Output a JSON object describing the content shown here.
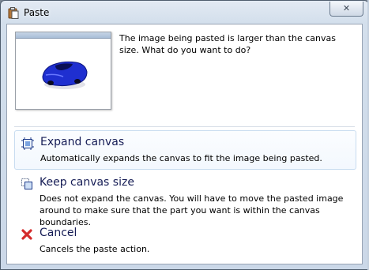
{
  "window": {
    "title": "Paste",
    "close_label": "✕"
  },
  "message": "The image being pasted is larger than the canvas size. What do you want to do?",
  "options": [
    {
      "title": "Expand canvas",
      "description": "Automatically expands the canvas to fit the image being pasted."
    },
    {
      "title": "Keep canvas size",
      "description": "Does not expand the canvas. You will have to move the pasted image around to make sure that the part you want is within the canvas boundaries."
    },
    {
      "title": "Cancel",
      "description": "Cancels the paste action."
    }
  ],
  "icons": {
    "window": "paste-icon",
    "expand": "expand-canvas-icon",
    "keep": "keep-canvas-icon",
    "cancel": "cancel-icon"
  },
  "colors": {
    "accent_text": "#151c55",
    "cancel_red": "#d42b2b",
    "car_blue": "#1f2fd0"
  }
}
